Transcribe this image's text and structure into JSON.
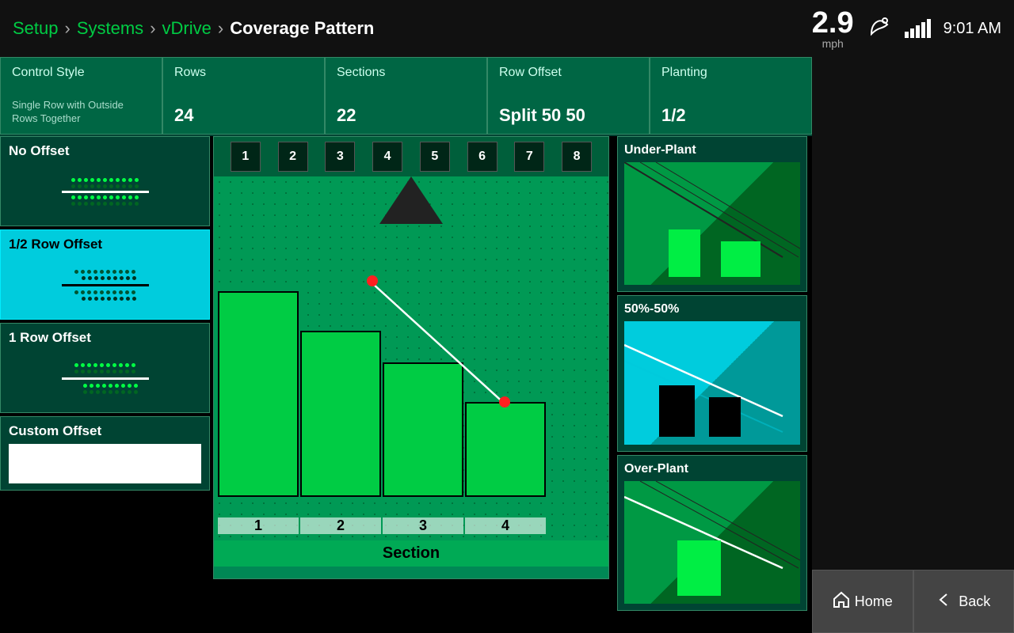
{
  "topbar": {
    "crumbs": [
      "Setup",
      "Systems",
      "vDrive"
    ],
    "title": "Coverage Pattern",
    "speed": "2.9",
    "speed_unit": "mph",
    "time": "9:01 AM"
  },
  "info_cards": [
    {
      "label": "Control Style",
      "value": "",
      "sub": "Single Row with Outside\nRows Together"
    },
    {
      "label": "Rows",
      "value": "24",
      "sub": ""
    },
    {
      "label": "Sections",
      "value": "22",
      "sub": ""
    },
    {
      "label": "Row Offset",
      "value": "Split 50 50",
      "sub": ""
    },
    {
      "label": "Planting",
      "value": "1/2",
      "sub": ""
    }
  ],
  "left_panel": {
    "options": [
      {
        "id": "no-offset",
        "label": "No Offset",
        "active": false
      },
      {
        "id": "half-row-offset",
        "label": "1/2 Row Offset",
        "active": true
      },
      {
        "id": "one-row-offset",
        "label": "1 Row Offset",
        "active": false
      }
    ],
    "custom_offset_label": "Custom Offset",
    "custom_offset_value": ""
  },
  "diagram": {
    "top_numbers": [
      "1",
      "2",
      "3",
      "4",
      "5",
      "6",
      "7",
      "8"
    ],
    "bottom_labels": [
      "1",
      "2",
      "3",
      "4"
    ],
    "section_label": "Section"
  },
  "mini_charts": {
    "under_plant_label": "Under-Plant",
    "fifty_fifty_label": "50%-50%",
    "over_plant_label": "Over-Plant"
  },
  "nav": {
    "home_label": "Home",
    "back_label": "Back"
  }
}
